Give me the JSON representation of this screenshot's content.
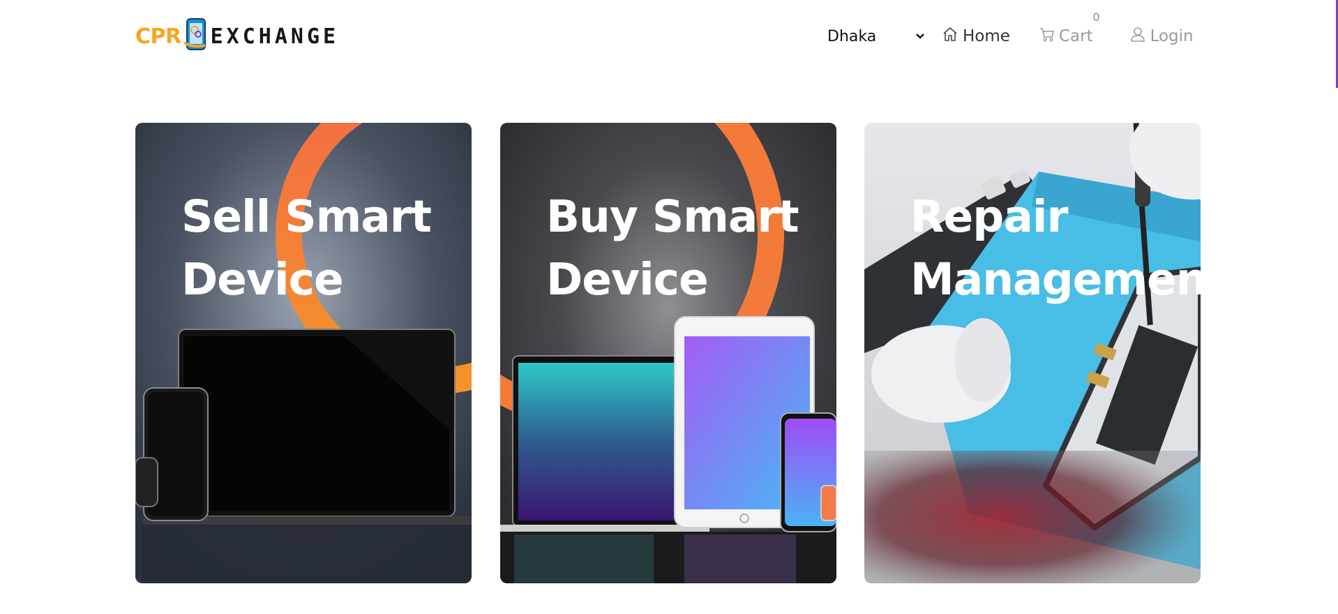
{
  "brand": {
    "logo_left": "CPR",
    "logo_right": "EXCHANGE",
    "accent": "#f5a623"
  },
  "nav": {
    "city": "Dhaka",
    "home_label": "Home",
    "cart_label": "Cart",
    "cart_count": "0",
    "login_label": "Login",
    "icons": [
      "chevron-down-icon",
      "home-icon",
      "cart-icon",
      "user-icon"
    ]
  },
  "cards": [
    {
      "title_line1": "Sell Smart",
      "title_line2": "Device"
    },
    {
      "title_line1": "Buy Smart",
      "title_line2": "Device"
    },
    {
      "title_line1": "Repair",
      "title_line2": "Management"
    }
  ],
  "colors": {
    "orange_ring": "#f47a3a",
    "repair_mat": "#48bde5"
  }
}
